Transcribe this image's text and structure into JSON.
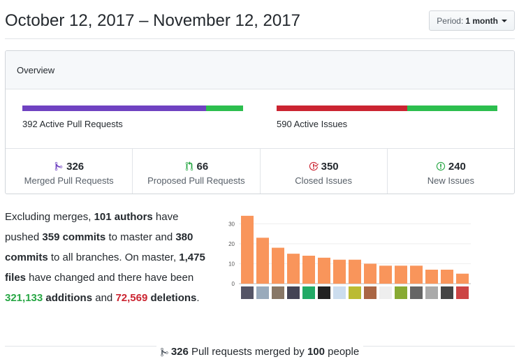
{
  "header": {
    "title": "October 12, 2017 – November 12, 2017",
    "period_prefix": "Period:",
    "period_value": "1 month"
  },
  "overview": {
    "heading": "Overview",
    "pull_requests": {
      "label": "392 Active Pull Requests",
      "merged": 326,
      "proposed": 66,
      "colors": {
        "merged": "#6f42c1",
        "proposed": "#2cbe4e"
      }
    },
    "issues": {
      "label": "590 Active Issues",
      "closed": 350,
      "new": 240,
      "colors": {
        "closed": "#cb2431",
        "new": "#2cbe4e"
      }
    },
    "stats": [
      {
        "count": "326",
        "label": "Merged Pull Requests",
        "icon": "git-merge-icon",
        "color": "#6f42c1"
      },
      {
        "count": "66",
        "label": "Proposed Pull Requests",
        "icon": "git-pull-request-icon",
        "color": "#28a745"
      },
      {
        "count": "350",
        "label": "Closed Issues",
        "icon": "issue-closed-icon",
        "color": "#cb2431"
      },
      {
        "count": "240",
        "label": "New Issues",
        "icon": "issue-opened-icon",
        "color": "#28a745"
      }
    ]
  },
  "summary": {
    "t1": "Excluding merges, ",
    "authors": "101 authors",
    "t2": " have pushed ",
    "commits_master": "359 commits",
    "t3": " to master and ",
    "commits_all": "380 commits",
    "t4": " to all branches. On master, ",
    "files": "1,475 files",
    "t5": " have changed and there have been ",
    "additions_num": "321,133",
    "additions_word": " additions",
    "t6": " and ",
    "deletions_num": "72,569",
    "deletions_word": "deletions",
    "t7": "."
  },
  "chart_data": {
    "type": "bar",
    "categories": [
      "",
      "",
      "",
      "",
      "",
      "",
      "",
      "",
      "",
      "",
      "",
      "",
      "",
      "",
      "",
      ""
    ],
    "values": [
      34,
      23,
      18,
      15,
      14,
      13,
      12,
      12,
      10,
      9,
      9,
      9,
      7,
      7,
      5,
      0
    ],
    "ylim": [
      0,
      35
    ],
    "yticks": [
      0,
      10,
      20,
      30
    ],
    "bar_color": "#f9955b",
    "grid": true,
    "legend": "none"
  },
  "footer": {
    "count": "326",
    "t1": " Pull requests merged by ",
    "people": "100",
    "t2": " people"
  }
}
